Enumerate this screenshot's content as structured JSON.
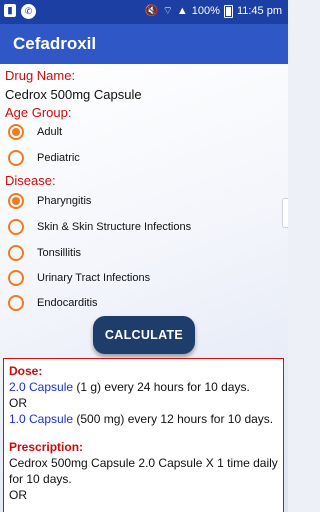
{
  "status_bar": {
    "time": "11:45 pm",
    "battery_percent": "100%",
    "icons": [
      "notification-icon",
      "phone-icon",
      "mute-icon",
      "wifi-icon",
      "signal-icon",
      "battery-icon"
    ]
  },
  "appbar": {
    "title": "Cefadroxil"
  },
  "drug": {
    "label": "Drug Name:",
    "value": "Cedrox 500mg Capsule"
  },
  "age_group": {
    "label": "Age Group:",
    "options": [
      {
        "label": "Adult",
        "checked": true
      },
      {
        "label": "Pediatric",
        "checked": false
      }
    ]
  },
  "disease": {
    "label": "Disease:",
    "options": [
      {
        "label": "Pharyngitis",
        "checked": true
      },
      {
        "label": "Skin & Skin Structure Infections",
        "checked": false
      },
      {
        "label": "Tonsillitis",
        "checked": false
      },
      {
        "label": "Urinary Tract Infections",
        "checked": false
      },
      {
        "label": "Endocarditis",
        "checked": false
      }
    ]
  },
  "calculate_label": "CALCULATE",
  "result": {
    "dose_heading": "Dose:",
    "dose1_qty": "2.0 Capsule",
    "dose1_rest": " (1 g) every 24 hours for 10 days.",
    "or_text": "OR",
    "dose2_qty": "1.0 Capsule",
    "dose2_rest": " (500 mg) every 12 hours for 10 days.",
    "prescription_heading": "Prescription:",
    "prescription_text": "Cedrox 500mg Capsule 2.0 Capsule X 1 time daily for 10 days.",
    "or_text2": "OR"
  },
  "colors": {
    "status_bar": "#1c3fa3",
    "app_bar": "#2f57c5",
    "label_red": "#d10a0a",
    "radio_orange": "#f07b1d",
    "button": "#1e3d6b",
    "dose_blue": "#1d2fdd"
  }
}
